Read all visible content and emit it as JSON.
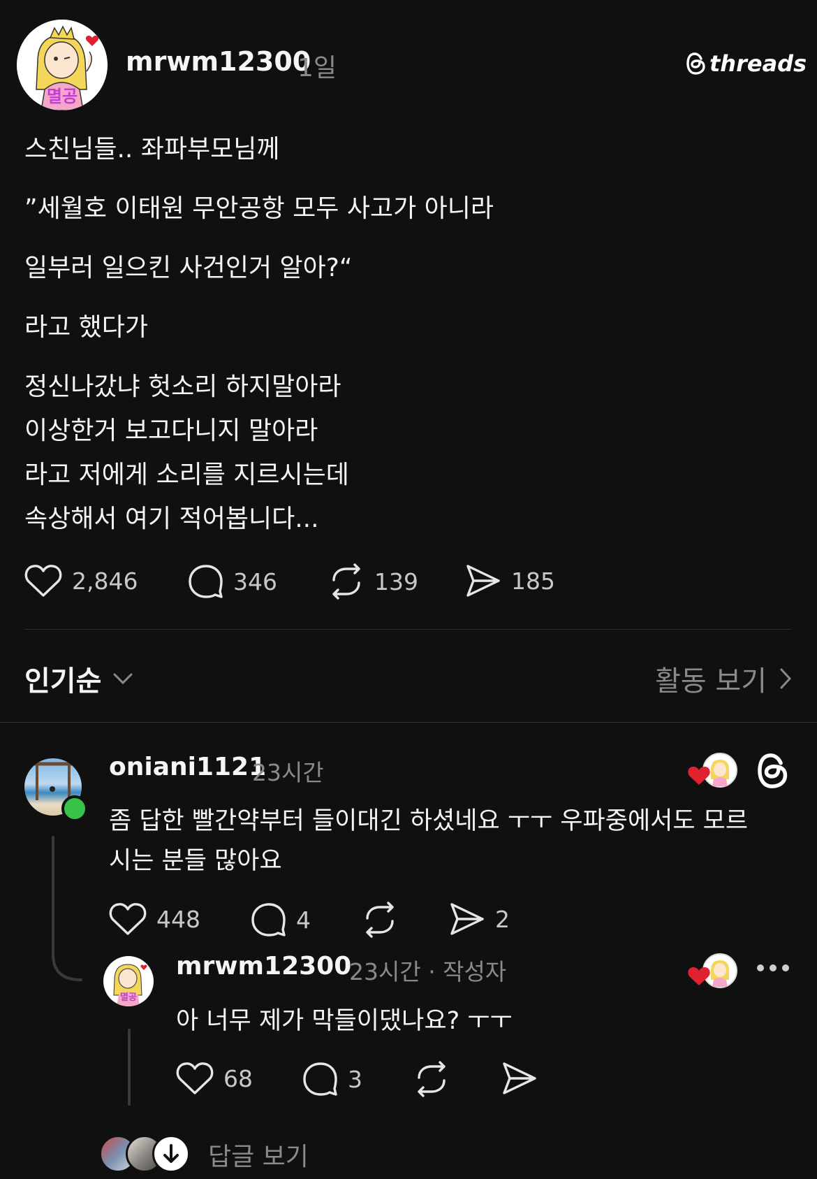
{
  "post": {
    "author": "mrwm12300",
    "time": "1일",
    "brand": "threads",
    "avatar_text": "멸공",
    "lines": [
      "스친님들.. 좌파부모님께",
      "”세월호 이태원 무안공항 모두 사고가 아니라",
      "일부러 일으킨 사건인거 알아?“",
      "라고 했다가",
      "정신나갔냐 헛소리 하지말아라",
      "이상한거 보고다니지 말아라",
      "라고 저에게 소리를 지르시는데",
      "속상해서 여기 적어봅니다..."
    ],
    "likes": "2,846",
    "comments": "346",
    "reposts": "139",
    "shares": "185"
  },
  "sort": {
    "label": "인기순",
    "activity": "활동 보기"
  },
  "reply1": {
    "author": "oniani1121",
    "time": "23시간",
    "text_line1": "좀 답한 빨간약부터 들이대긴 하셨네요 ㅜㅜ 우파중에서도 모르",
    "text_line2": "시는 분들 많아요",
    "likes": "448",
    "comments": "4",
    "shares": "2"
  },
  "reply2": {
    "author": "mrwm12300",
    "time": "23시간 · 작성자",
    "text": "아 너무 제가 막들이댔나요? ㅜㅜ",
    "likes": "68",
    "comments": "3"
  },
  "more_replies": {
    "label": "답글 보기"
  },
  "colors": {
    "background": "#101010",
    "text": "#f3f5f7",
    "muted": "#8a8a8a",
    "heart_red": "#e0212f",
    "online_green": "#39c34a"
  }
}
